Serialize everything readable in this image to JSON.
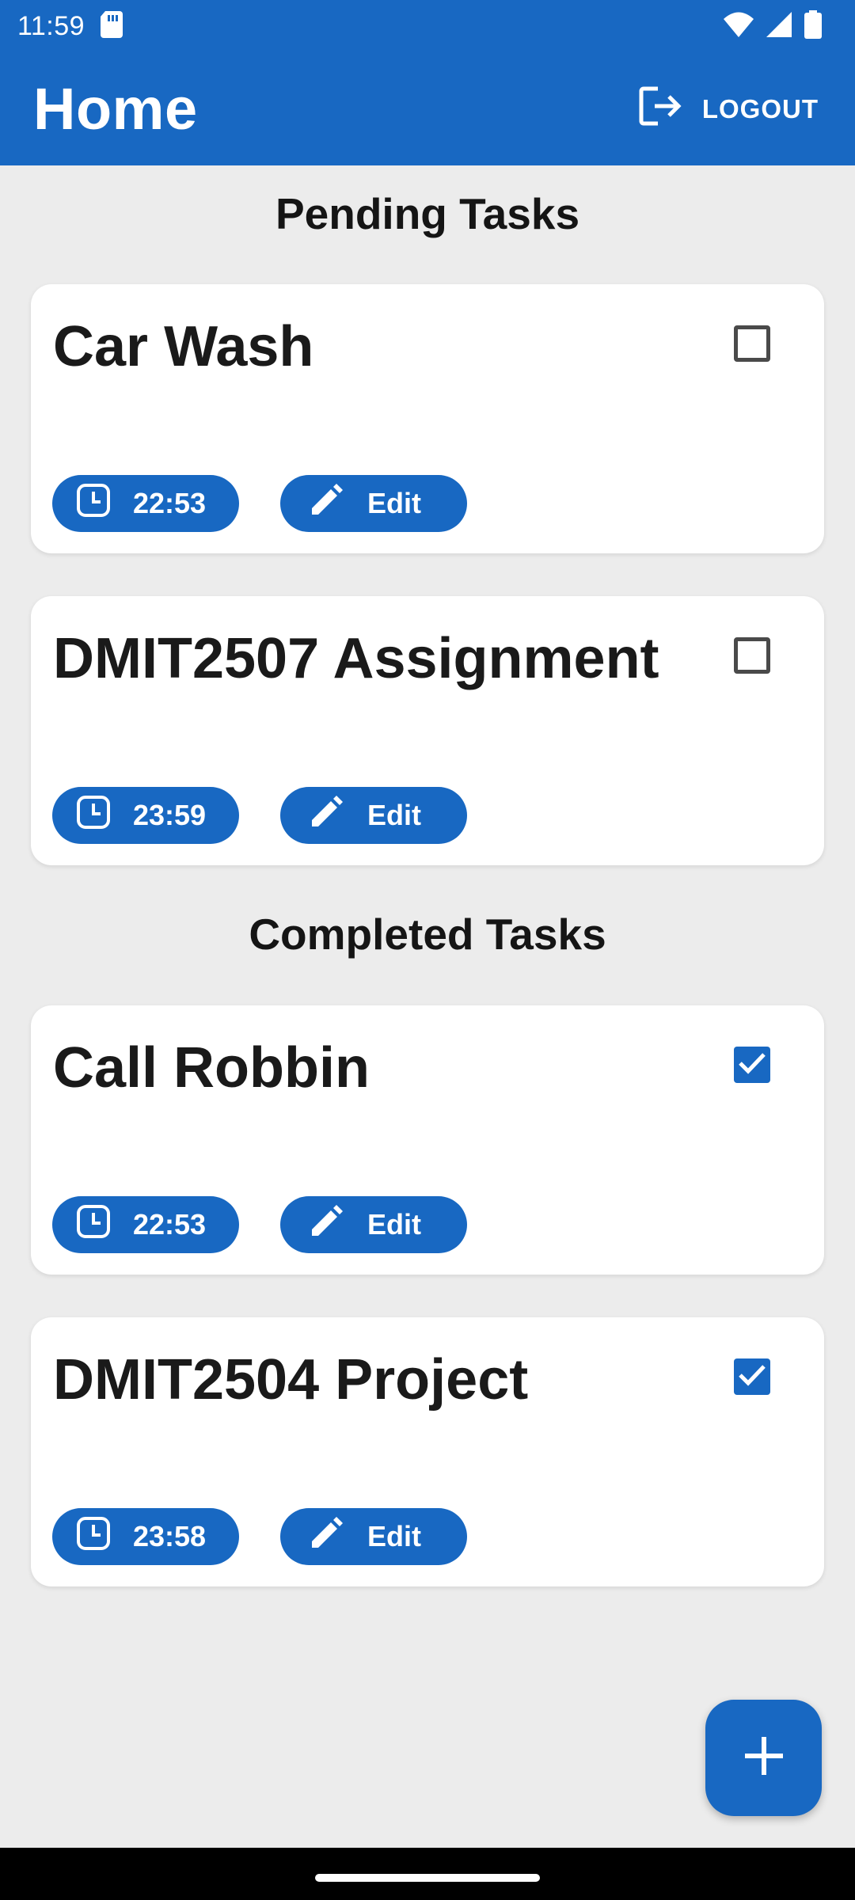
{
  "status_bar": {
    "time": "11:59",
    "icons": [
      "sd-card-icon",
      "wifi-icon",
      "signal-icon",
      "battery-icon"
    ]
  },
  "app_bar": {
    "title": "Home",
    "logout_label": "LOGOUT",
    "logout_icon": "logout-icon"
  },
  "pending": {
    "heading": "Pending Tasks",
    "tasks": [
      {
        "title": "Car Wash",
        "time": "22:53",
        "edit_label": "Edit",
        "done": false
      },
      {
        "title": "DMIT2507 Assignment",
        "time": "23:59",
        "edit_label": "Edit",
        "done": false
      }
    ]
  },
  "completed": {
    "heading": "Completed Tasks",
    "tasks": [
      {
        "title": "Call Robbin",
        "time": "22:53",
        "edit_label": "Edit",
        "done": true
      },
      {
        "title": "DMIT2504 Project",
        "time": "23:58",
        "edit_label": "Edit",
        "done": true
      }
    ]
  },
  "fab": {
    "icon": "plus-icon"
  },
  "colors": {
    "primary": "#1868c2",
    "background": "#ececec",
    "card": "#ffffff",
    "text": "#1a1a1a"
  }
}
